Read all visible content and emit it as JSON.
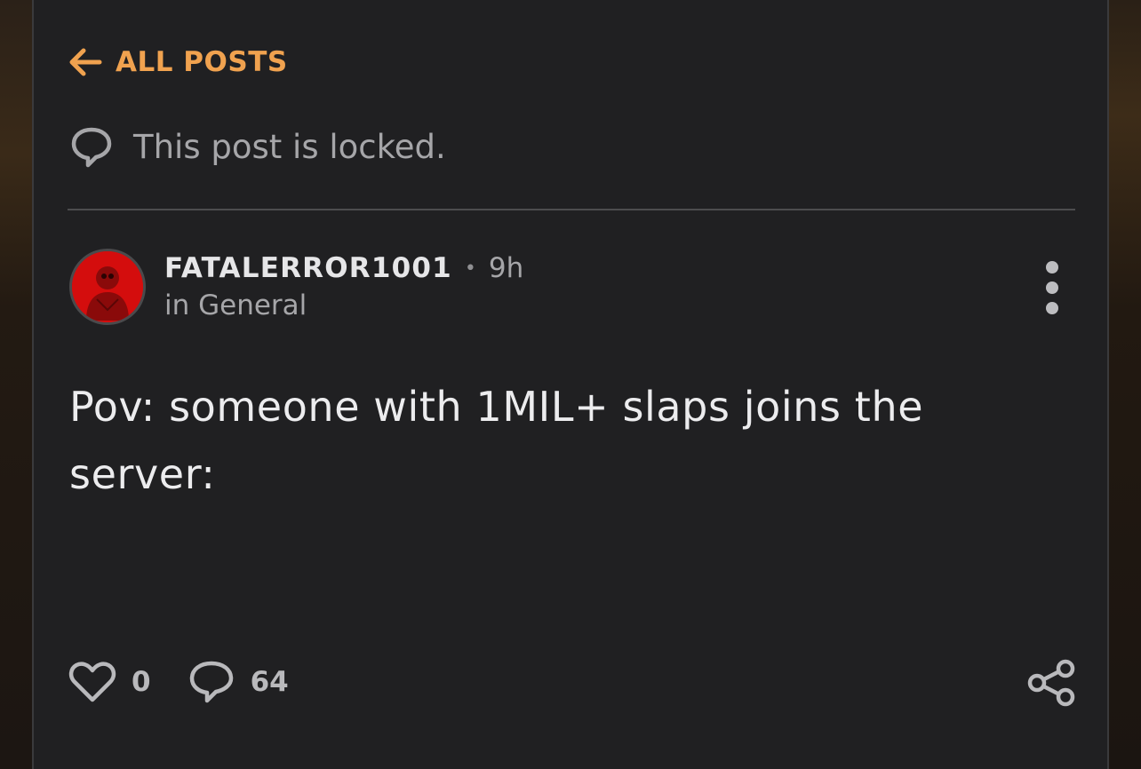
{
  "nav": {
    "back_label": "ALL POSTS",
    "back_icon": "arrow-left-icon"
  },
  "notice": {
    "text": "This post is locked.",
    "icon": "speech-bubble-icon"
  },
  "post": {
    "author": "FATALERROR1001",
    "separator": "•",
    "time": "9h",
    "category": "in General",
    "body": "Pov: someone with 1MIL+ slaps joins the server:",
    "likes": "0",
    "comments": "64"
  },
  "colors": {
    "accent": "#f0a24f",
    "panel": "#202022",
    "text": "#ececee",
    "muted": "#a6a6a9"
  }
}
